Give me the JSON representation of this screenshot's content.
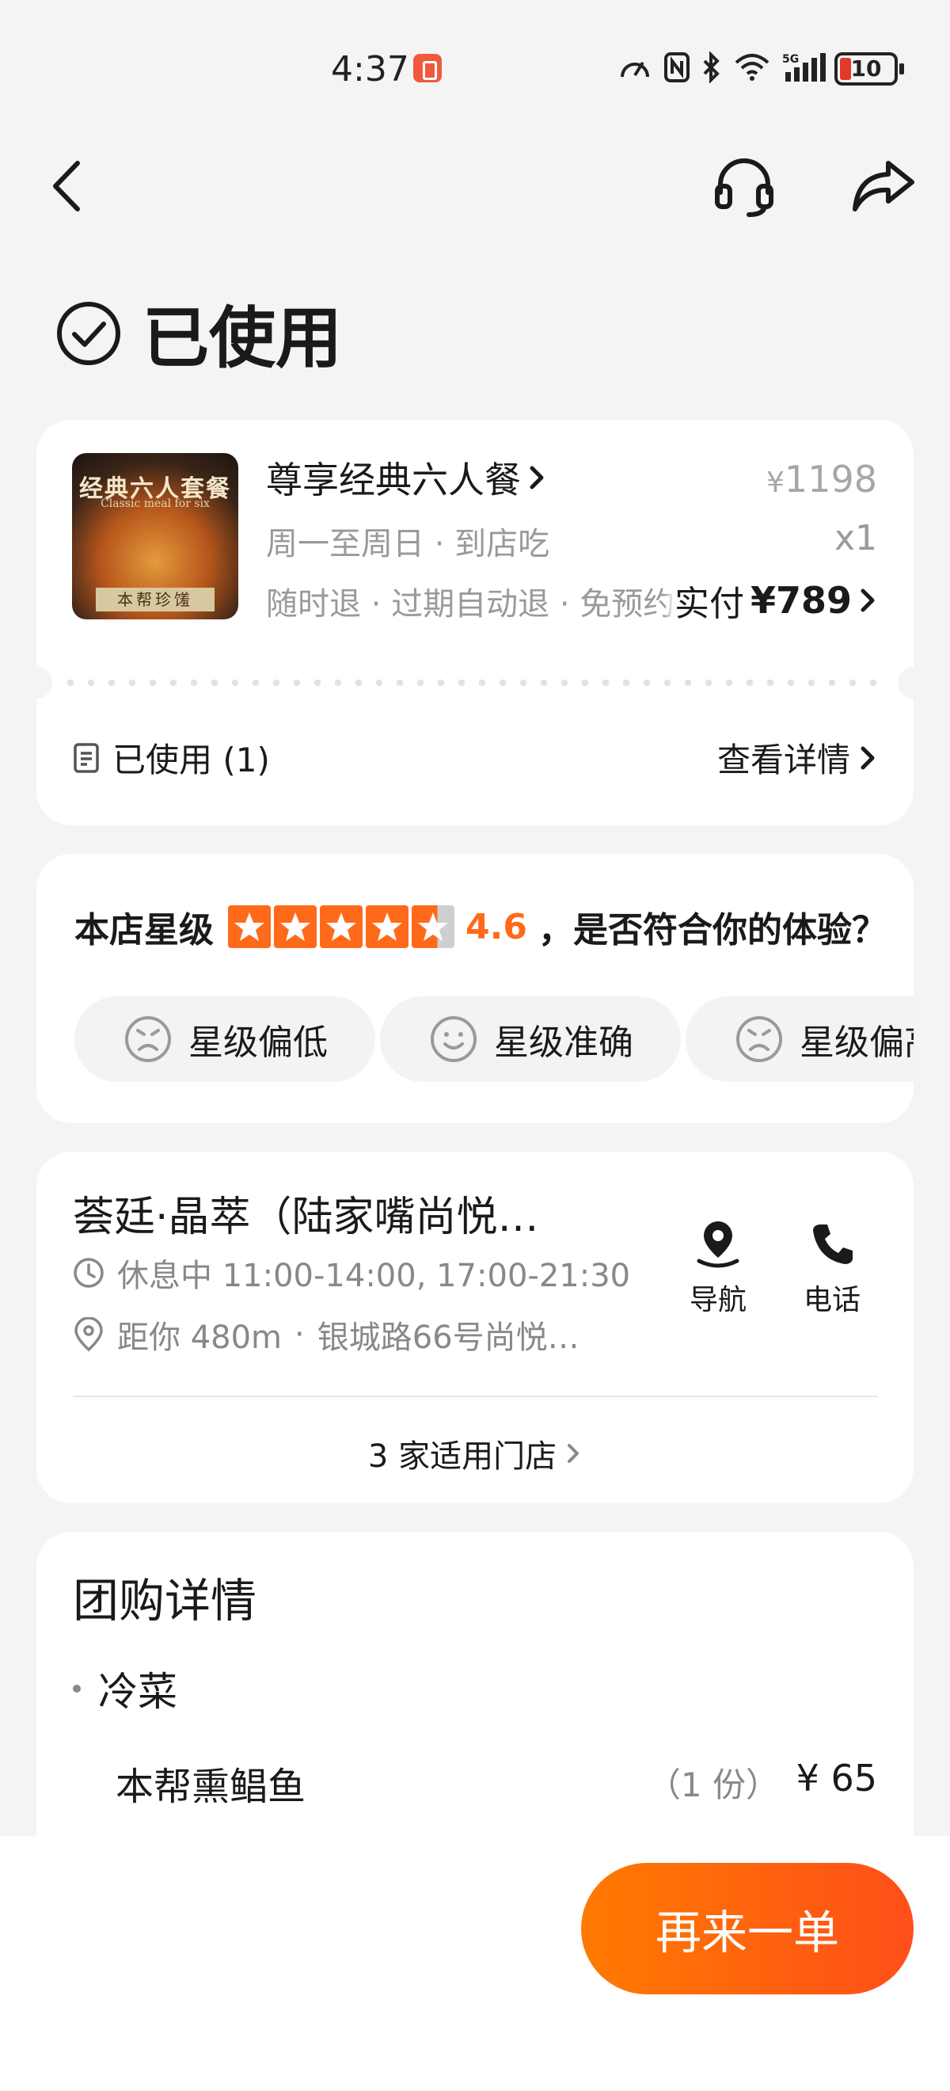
{
  "status_bar": {
    "time": "4:37",
    "battery": "10"
  },
  "order": {
    "status": "已使用",
    "product": {
      "image_title": "经典六人套餐",
      "image_subtitle": "Classic meal for six",
      "image_badge": "本帮珍馐",
      "name": "尊享经典六人餐",
      "original_price": "1198",
      "currency": "¥",
      "schedule": "周一至周日 · 到店吃",
      "quantity": "x1",
      "tags": "随时退 · 过期自动退 · 免预约",
      "paid_label": "实付",
      "paid_amount": "¥789"
    },
    "used_label": "已使用 (1)",
    "view_details": "查看详情"
  },
  "rating": {
    "label": "本店星级",
    "score": "4.6",
    "score_value": 4.6,
    "question": "，是否符合你的体验？",
    "options": [
      "星级偏低",
      "星级准确",
      "星级偏高"
    ]
  },
  "shop": {
    "name": "荟廷·晶萃（陆家嘴尚悦…",
    "hours": "休息中 11:00-14:00, 17:00-21:30",
    "distance": "距你 480m",
    "address": "银城路66号尚悦…",
    "nav_label": "导航",
    "call_label": "电话",
    "applicable_stores": "3 家适用门店"
  },
  "deal_details": {
    "title": "团购详情",
    "category": "冷菜",
    "items": [
      {
        "name": "本帮熏鲳鱼",
        "qty": "（1 份）",
        "price": "¥ 65"
      }
    ]
  },
  "actions": {
    "reorder": "再来一单"
  },
  "colors": {
    "accent": "#ff6a1a",
    "button_start": "#ff7a00",
    "button_end": "#ff4f1a"
  }
}
